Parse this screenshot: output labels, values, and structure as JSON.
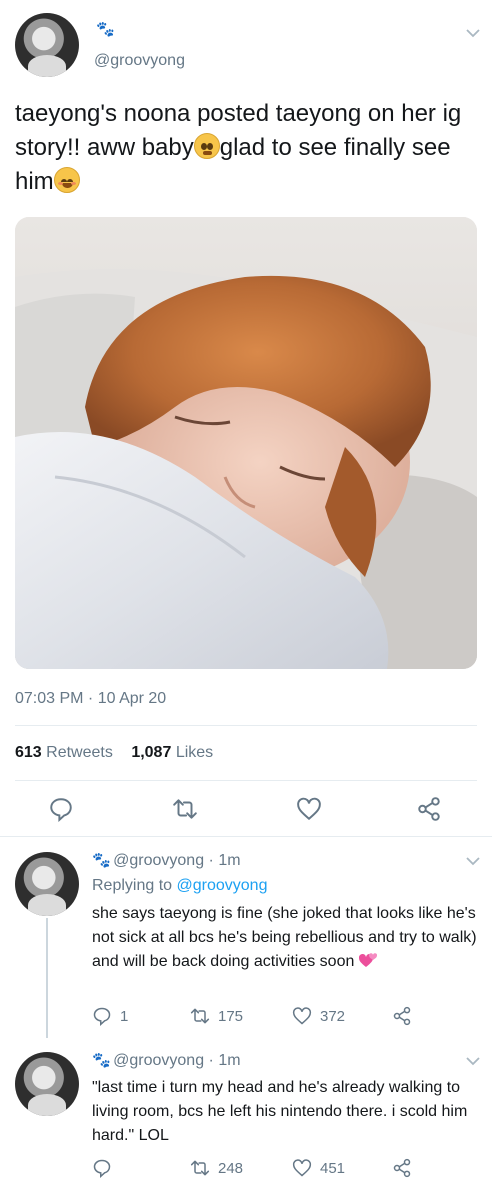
{
  "main_tweet": {
    "handle": "@groovyong",
    "text_part1": "taeyong's noona posted taeyong on her ig story!! aww baby",
    "emoji1": "pleading-face",
    "text_part2": "glad to see finally see him",
    "emoji2": "smiling-face",
    "timestamp": "07:03 PM · 10 Apr 20",
    "retweets_count": "613",
    "retweets_label": "Retweets",
    "likes_count": "1,087",
    "likes_label": "Likes"
  },
  "replies": [
    {
      "handle_line": "@groovyong · 1m",
      "replying_label": "Replying to",
      "replying_handle": "@groovyong",
      "text": "she says taeyong is fine (she joked that looks like he's not sick at all bcs he's being rebellious and try to walk) and will be back doing activities soon",
      "emoji": "two-hearts",
      "reply_count": "1",
      "retweet_count": "175",
      "like_count": "372"
    },
    {
      "handle_line": "@groovyong · 1m",
      "text": "\"last time i turn my head and he's already walking to living room, bcs he left his nintendo there. i scold him hard.\" LOL",
      "reply_count": "",
      "retweet_count": "248",
      "like_count": "451"
    }
  ],
  "colors": {
    "text": "#14171a",
    "secondary": "#657786",
    "link": "#1da1f2",
    "divider": "#e6ecf0"
  }
}
